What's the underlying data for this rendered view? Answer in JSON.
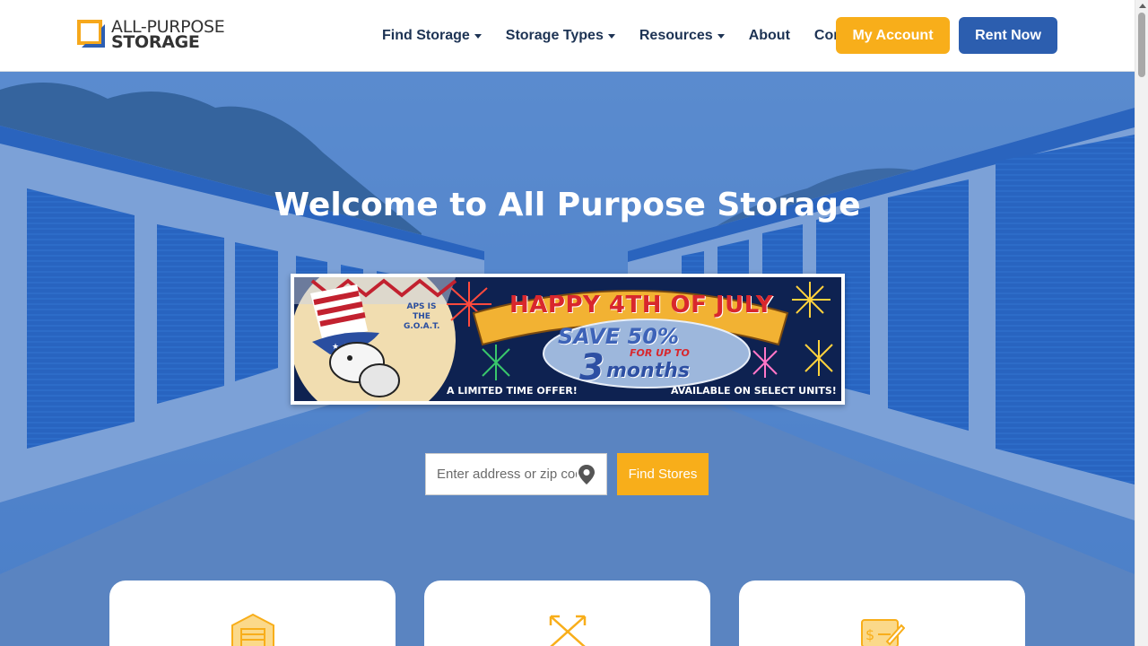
{
  "header": {
    "logo": {
      "line1": "ALL-PURPOSE",
      "line2": "STORAGE"
    },
    "nav": [
      {
        "label": "Find Storage",
        "dropdown": true
      },
      {
        "label": "Storage Types",
        "dropdown": true
      },
      {
        "label": "Resources",
        "dropdown": true
      },
      {
        "label": "About",
        "dropdown": false
      },
      {
        "label": "Contact",
        "dropdown": false
      }
    ],
    "my_account_label": "My Account",
    "rent_now_label": "Rent Now"
  },
  "hero": {
    "title": "Welcome to All Purpose Storage",
    "banner": {
      "goat_text": "APS IS THE G.O.A.T.",
      "headline": "HAPPY 4TH OF JULY",
      "save": "SAVE 50%",
      "for_up_to": "FOR UP TO",
      "months_number": "3",
      "months_word": "months",
      "left_note": "A LIMITED TIME OFFER!",
      "right_note": "AVAILABLE ON SELECT UNITS!"
    },
    "search": {
      "placeholder": "Enter address or zip code",
      "button_label": "Find Stores"
    }
  },
  "cards": [
    {
      "icon": "storage-unit-icon"
    },
    {
      "icon": "expand-arrows-icon"
    },
    {
      "icon": "check-payment-icon"
    }
  ],
  "colors": {
    "brand_blue": "#2c5eaf",
    "brand_orange": "#f8ae1a",
    "nav_text": "#1d3354",
    "hero_overlay": "#3068be"
  }
}
